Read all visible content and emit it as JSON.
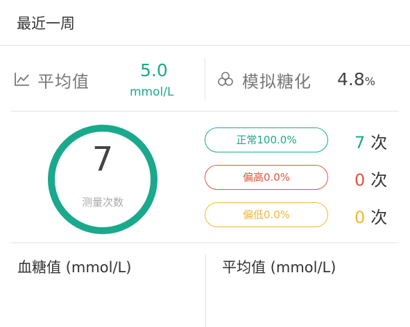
{
  "header": {
    "title": "最近一周"
  },
  "stats": {
    "average": {
      "label": "平均值",
      "value": "5.0",
      "unit": "mmol/L",
      "icon": "line-chart-icon"
    },
    "hba1c": {
      "label": "模拟糖化",
      "value": "4.8",
      "unit": "%",
      "icon": "circles-icon"
    }
  },
  "summary": {
    "count": "7",
    "count_label": "测量次数",
    "ring_color": "#1aa98c",
    "categories": [
      {
        "label": "正常100.0%",
        "count": "7",
        "unit": "次",
        "color": "#1aa98c"
      },
      {
        "label": "偏高0.0%",
        "count": "0",
        "unit": "次",
        "color": "#e0533f"
      },
      {
        "label": "偏低0.0%",
        "count": "0",
        "unit": "次",
        "color": "#f1b637"
      }
    ]
  },
  "bottom": {
    "left_title": "血糖值 (mmol/L)",
    "right_title": "平均值 (mmol/L)"
  }
}
